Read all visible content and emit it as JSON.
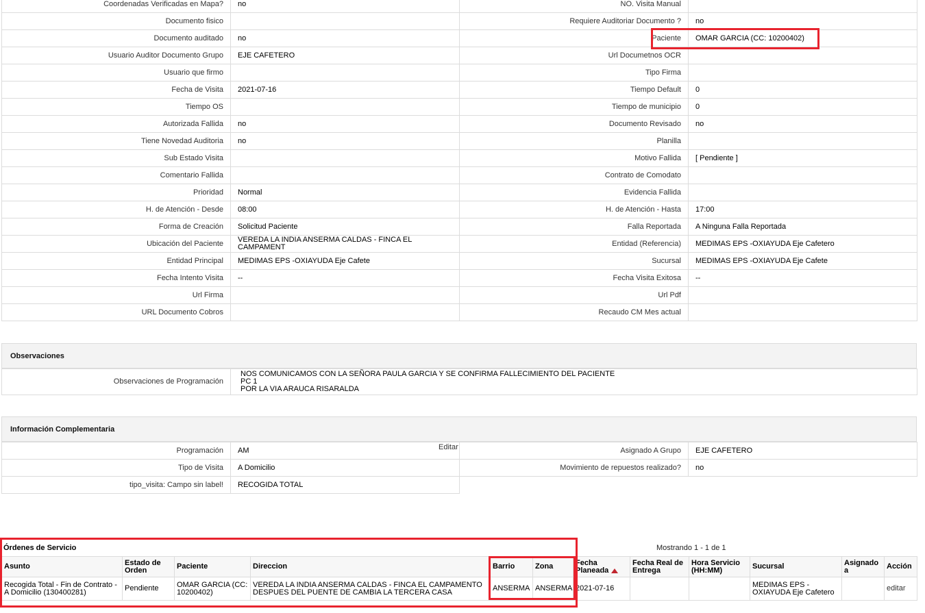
{
  "detail_rows": [
    {
      "left_label": "Coordenadas Verificadas en Mapa?",
      "left_value": "no",
      "right_label": "NO. Visita Manual",
      "right_value": ""
    },
    {
      "left_label": "Documento fisico",
      "left_value": "",
      "right_label": "Requiere Auditoriar Documento ?",
      "right_value": "no"
    },
    {
      "left_label": "Documento auditado",
      "left_value": "no",
      "right_label": "Paciente",
      "right_value": "OMAR GARCIA (CC: 10200402)"
    },
    {
      "left_label": "Usuario Auditor Documento Grupo",
      "left_value": "EJE CAFETERO",
      "right_label": "Url Documetnos OCR",
      "right_value": ""
    },
    {
      "left_label": "Usuario que firmo",
      "left_value": "",
      "right_label": "Tipo Firma",
      "right_value": ""
    },
    {
      "left_label": "Fecha de Visita",
      "left_value": "2021-07-16",
      "right_label": "Tiempo Default",
      "right_value": "0"
    },
    {
      "left_label": "Tiempo OS",
      "left_value": "",
      "right_label": "Tiempo de municipio",
      "right_value": "0"
    },
    {
      "left_label": "Autorizada Fallida",
      "left_value": "no",
      "right_label": "Documento Revisado",
      "right_value": "no"
    },
    {
      "left_label": "Tiene Novedad Auditoria",
      "left_value": "no",
      "right_label": "Planilla",
      "right_value": ""
    },
    {
      "left_label": "Sub Estado Visita",
      "left_value": "",
      "right_label": "Motivo Fallida",
      "right_value": "[ Pendiente ]"
    },
    {
      "left_label": "Comentario Fallida",
      "left_value": "",
      "right_label": "Contrato de Comodato",
      "right_value": ""
    },
    {
      "left_label": "Prioridad",
      "left_value": "Normal",
      "right_label": "Evidencia Fallida",
      "right_value": ""
    },
    {
      "left_label": "H. de Atención - Desde",
      "left_value": "08:00",
      "right_label": "H. de Atención - Hasta",
      "right_value": "17:00"
    },
    {
      "left_label": "Forma de Creación",
      "left_value": "Solicitud Paciente",
      "right_label": "Falla Reportada",
      "right_value": "A Ninguna Falla Reportada"
    },
    {
      "left_label": "Ubicación del Paciente",
      "left_value": "VEREDA LA INDIA ANSERMA CALDAS - FINCA EL CAMPAMENT",
      "right_label": "Entidad (Referencia)",
      "right_value": "MEDIMAS EPS -OXIAYUDA Eje Cafetero"
    },
    {
      "left_label": "Entidad Principal",
      "left_value": "MEDIMAS EPS -OXIAYUDA Eje Cafete",
      "right_label": "Sucursal",
      "right_value": "MEDIMAS EPS -OXIAYUDA Eje Cafete"
    },
    {
      "left_label": "Fecha Intento Visita",
      "left_value": "--",
      "right_label": "Fecha Visita Exitosa",
      "right_value": "--"
    },
    {
      "left_label": "Url Firma",
      "left_value": "",
      "right_label": "Url Pdf",
      "right_value": ""
    },
    {
      "left_label": "URL Documento Cobros",
      "left_value": "",
      "right_label": "Recaudo CM Mes actual",
      "right_value": ""
    }
  ],
  "observaciones": {
    "title": "Observaciones",
    "label": "Observaciones de Programación",
    "value": "NOS COMUNICAMOS CON LA SEÑORA PAULA GARCIA Y SE CONFIRMA FALLECIMIENTO DEL PACIENTE\nPC 1\nPOR LA VIA ARAUCA RISARALDA"
  },
  "info": {
    "title": "Información Complementaria",
    "edit_label": "Editar",
    "rows": [
      {
        "left_label": "Programación",
        "left_value": "AM",
        "right_label": "Asignado A Grupo",
        "right_value": "EJE CAFETERO"
      },
      {
        "left_label": "Tipo de Visita",
        "left_value": "A Domicilio",
        "right_label": "Movimiento de repuestos realizado?",
        "right_value": "no"
      },
      {
        "left_label": "tipo_visita: Campo sin label!",
        "left_value": "RECOGIDA TOTAL"
      }
    ]
  },
  "orders": {
    "title": "Órdenes de Servicio",
    "count_text": "Mostrando 1 - 1 de 1",
    "columns": [
      "Asunto",
      "Estado de Orden",
      "Paciente",
      "Direccion",
      "Barrio",
      "Zona",
      "Fecha Planeada",
      "Fecha Real de Entrega",
      "Hora Servicio (HH:MM)",
      "Sucursal",
      "Asignado a",
      "Acción"
    ],
    "rows": [
      [
        "Recogida Total - Fin de Contrato - A Domicilio (130400281)",
        "Pendiente",
        "OMAR GARCIA (CC: 10200402)",
        "VEREDA LA INDIA ANSERMA CALDAS - FINCA EL CAMPAMENTO DESPUES DEL PUENTE DE CAMBIA LA TERCERA CASA",
        "ANSERMA",
        "ANSERMA",
        "2021-07-16",
        "",
        "",
        "MEDIMAS EPS - OXIAYUDA Eje Cafetero",
        "",
        "editar"
      ]
    ]
  },
  "colors": {
    "highlight": "#e8232e",
    "border": "#dcdcdc",
    "header_bg": "#f3f3f3"
  }
}
